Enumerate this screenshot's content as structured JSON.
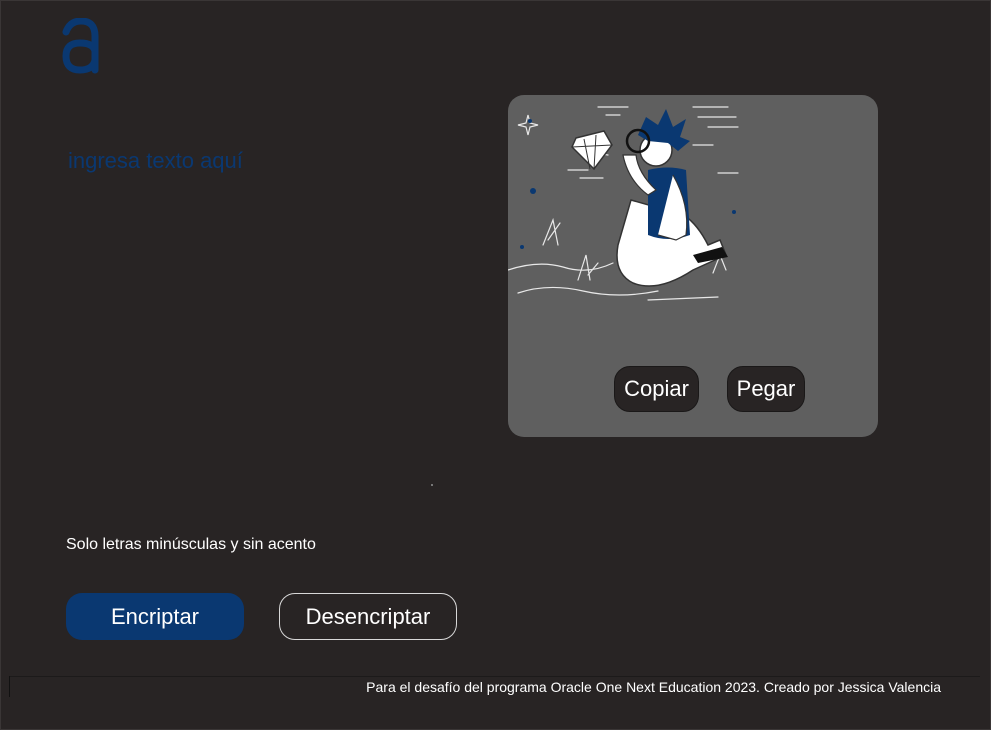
{
  "logo": {
    "letter": "a",
    "color": "#0a3871"
  },
  "input": {
    "placeholder": "ingresa texto aquí",
    "value": ""
  },
  "output_panel": {
    "illustration": "person-with-magnifying-glass-and-diamond",
    "copy_label": "Copiar",
    "paste_label": "Pegar"
  },
  "hint": {
    "text": "Solo letras minúsculas y sin acento"
  },
  "actions": {
    "encrypt_label": "Encriptar",
    "decrypt_label": "Desencriptar"
  },
  "footer": {
    "text": "Para el desafío del programa Oracle One Next Education 2023. Creado por Jessica Valencia"
  },
  "colors": {
    "background": "#282424",
    "accent": "#0a3871",
    "panel": "#5f5f5f",
    "text": "#ffffff"
  }
}
